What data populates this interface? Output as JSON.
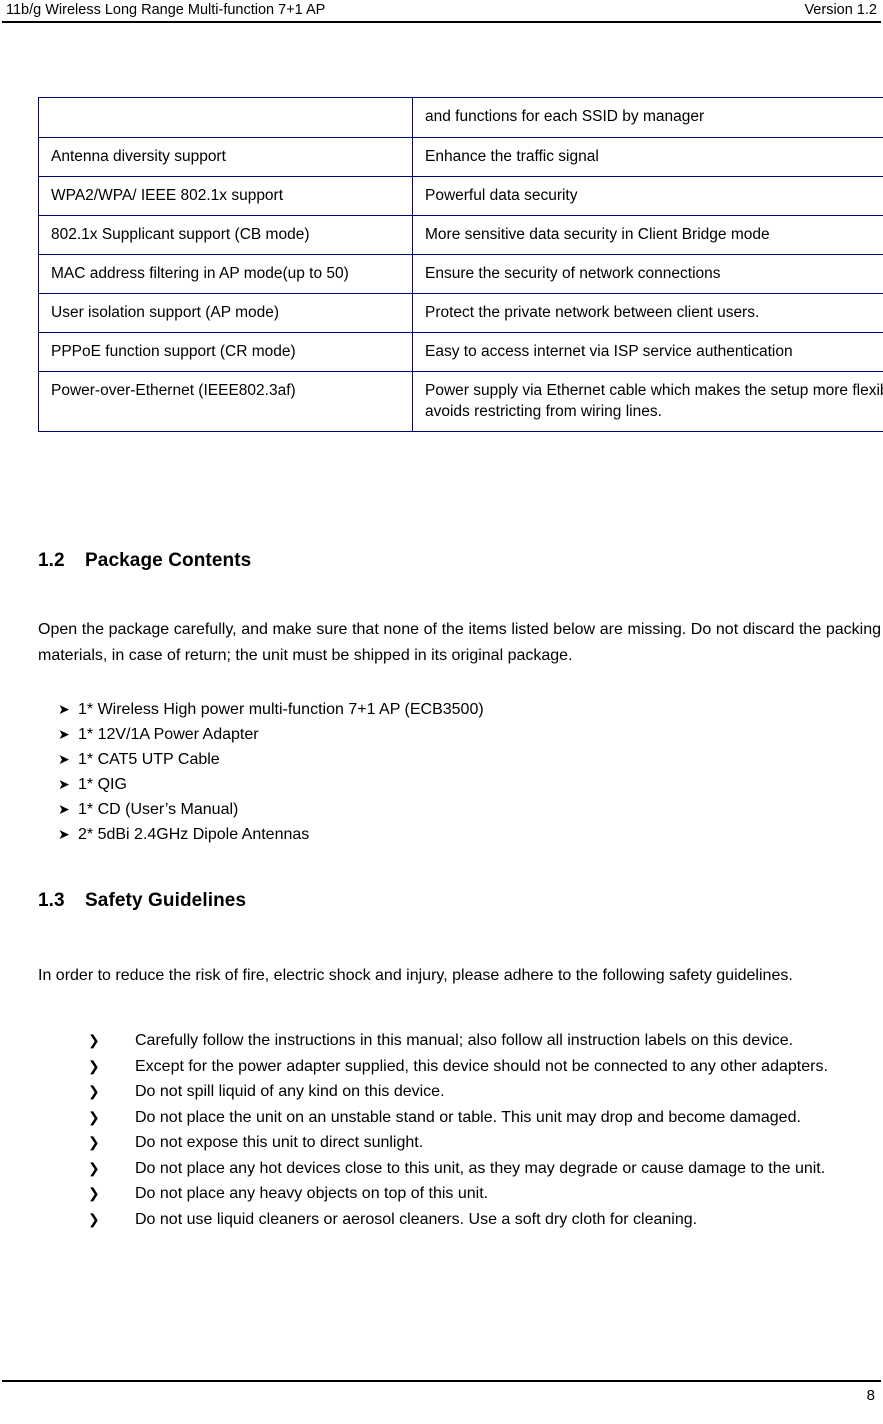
{
  "header": {
    "left_text": "11b/g Wireless Long Range Multi-function 7+1 AP",
    "right_text": "Version 1.2"
  },
  "spec_table": {
    "rows": [
      {
        "feature": "",
        "benefit": "and functions for each SSID by manager"
      },
      {
        "feature": "Antenna diversity support",
        "benefit": "Enhance the traffic signal"
      },
      {
        "feature": "WPA2/WPA/ IEEE 802.1x support",
        "benefit": "Powerful data security"
      },
      {
        "feature": "802.1x Supplicant support (CB mode)",
        "benefit": "More sensitive data security in Client Bridge mode"
      },
      {
        "feature": "MAC address filtering in AP mode(up to 50)",
        "benefit": "Ensure the security of network connections"
      },
      {
        "feature": "User isolation support (AP mode)",
        "benefit": "Protect the private network between client users."
      },
      {
        "feature": "PPPoE function support (CR mode)",
        "benefit": "Easy to access internet via ISP service authentication"
      },
      {
        "feature": "Power-over-Ethernet (IEEE802.3af)",
        "benefit": "Power supply via Ethernet cable which makes the setup more flexible avoids restricting from wiring lines."
      }
    ]
  },
  "section_package": {
    "number": "1.2",
    "title": "Package Contents",
    "intro": "Open the package carefully, and make sure that none of the items listed below are missing. Do not discard the packing materials, in case of return; the unit must be shipped in its original package.",
    "bullet_glyph": "➤",
    "items": [
      "1* Wireless High power multi-function 7+1 AP  (ECB3500)",
      "1* 12V/1A Power Adapter",
      "1* CAT5 UTP Cable",
      "1* QIG",
      "1* CD (User’s Manual)",
      "2* 5dBi 2.4GHz Dipole Antennas"
    ]
  },
  "section_safety": {
    "number": "1.3",
    "title": "Safety Guidelines",
    "intro": "In order to reduce the risk of fire, electric shock and injury, please adhere to the following safety guidelines.",
    "bullet_glyph": "❯",
    "items": [
      "Carefully follow the instructions in this manual; also follow all instruction labels on this device.",
      "Except for the power adapter supplied, this device should not be connected to any other adapters.",
      "Do not spill liquid of any kind on this device.",
      "Do not place the unit on an unstable stand or table. This unit may drop and become damaged.",
      "Do not expose this unit to direct sunlight.",
      "Do not place any hot devices close to this unit, as they may degrade or cause damage to the unit.",
      "Do not place any heavy objects on top of this unit.",
      "Do not use liquid cleaners or aerosol cleaners. Use a soft dry cloth for cleaning."
    ]
  },
  "footer": {
    "page_number": "8"
  },
  "colors": {
    "table_border": "#000080",
    "rule": "#000000",
    "text": "#000000",
    "page_background": "#ffffff"
  }
}
